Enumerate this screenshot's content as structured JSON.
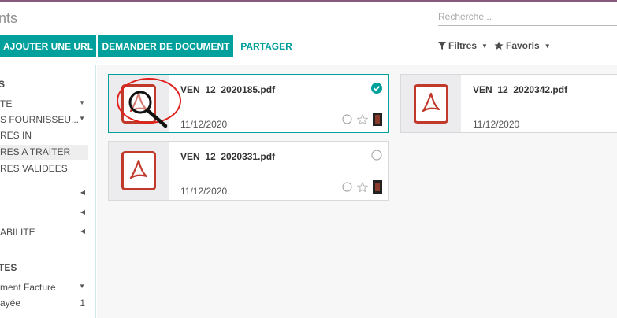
{
  "header": {
    "title": "nts",
    "search": {
      "placeholder": "Recherche...",
      "value": ""
    }
  },
  "toolbar": {
    "add_url_label": "AJOUTER UNE URL",
    "request_label": "DEMANDER DE DOCUMENT",
    "share_label": "PARTAGER",
    "filters_label": "Filtres",
    "favorites_label": "Favoris"
  },
  "sidebar": {
    "heading_1": "S",
    "items_1": [
      {
        "label": "TE",
        "arrow": "▼"
      },
      {
        "label": "S FOURNISSEU...",
        "arrow": "▼"
      },
      {
        "label": "RES IN",
        "arrow": ""
      },
      {
        "label": "RES A TRAITER",
        "arrow": ""
      },
      {
        "label": "RES VALIDEES",
        "arrow": ""
      },
      {
        "label": "",
        "arrow": "◀"
      },
      {
        "label": "",
        "arrow": "◀"
      },
      {
        "label": "ABILITE",
        "arrow": "◀"
      }
    ],
    "heading_2": "TES",
    "items_2": [
      {
        "label": "ment Facture",
        "arrow": "▼",
        "count": ""
      },
      {
        "label": "ayée",
        "arrow": "",
        "count": "1"
      }
    ]
  },
  "documents": [
    {
      "name": "VEN_12_2020185.pdf",
      "date": "11/12/2020",
      "selected": true
    },
    {
      "name": "VEN_12_2020342.pdf",
      "date": "11/12/2020",
      "selected": false
    },
    {
      "name": "VEN_12_2020331.pdf",
      "date": "11/12/2020",
      "selected": false
    }
  ],
  "colors": {
    "accent": "#00a09d",
    "brand": "#875a7b",
    "pdf": "#c0392b",
    "annotation": "#e0201b"
  }
}
